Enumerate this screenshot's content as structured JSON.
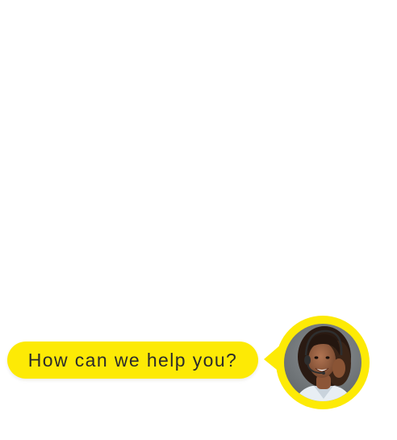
{
  "chat_widget": {
    "prompt_text": "How can we help you?",
    "avatar_icon": "support-agent-headset-avatar",
    "accent_color": "#fdea05"
  }
}
